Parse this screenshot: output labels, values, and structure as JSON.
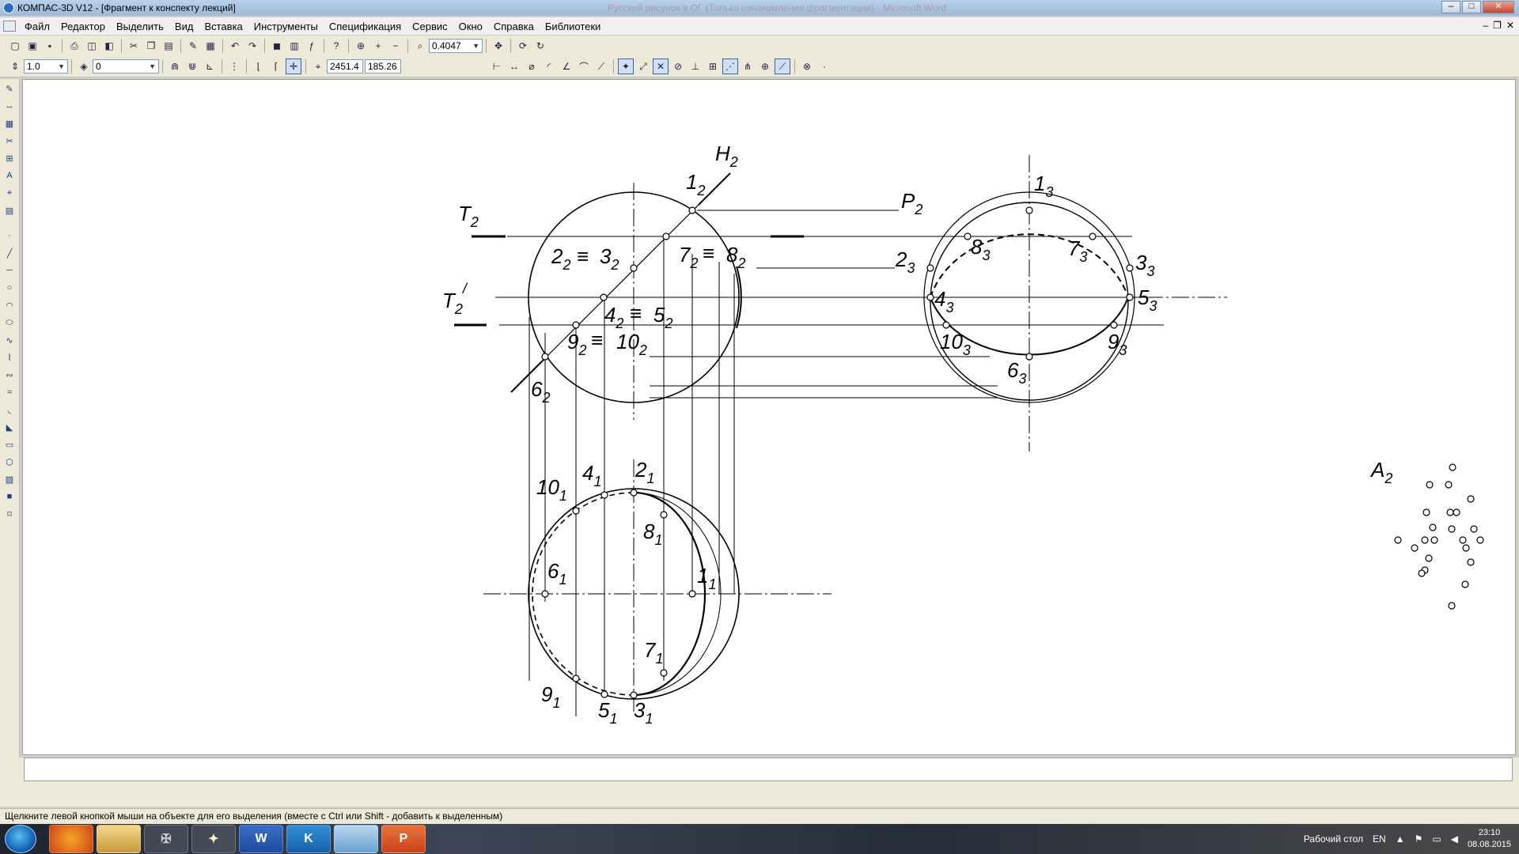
{
  "window": {
    "title": "КОМПАС-3D V12 - [Фрагмент к конспекту лекций]",
    "blurred_tab": "Русский рисунок в ОГ (Только ознакомления фрагментации) - Microsoft Word",
    "minimize": "–",
    "maximize": "□",
    "close": "✕"
  },
  "menu": {
    "items": [
      "Файл",
      "Редактор",
      "Выделить",
      "Вид",
      "Вставка",
      "Инструменты",
      "Спецификация",
      "Сервис",
      "Окно",
      "Справка",
      "Библиотеки"
    ],
    "doc_min": "–",
    "doc_restore": "❐",
    "doc_close": "✕"
  },
  "toolbar1": {
    "zoom_value": "0.4047"
  },
  "toolbar2": {
    "step_value": "1.0",
    "layer_value": "0",
    "coord_x": "2451.4",
    "coord_y": "185.26"
  },
  "drawing": {
    "labels": [
      {
        "main": "H",
        "sub": "2"
      },
      {
        "main": "1",
        "sub": "2"
      },
      {
        "main": "T",
        "sub": "2"
      },
      {
        "main": "P",
        "sub": "2"
      },
      {
        "main": "1",
        "sub": "3"
      },
      {
        "main": "2",
        "sub": "2"
      },
      {
        "main": "≡",
        "sub": ""
      },
      {
        "main": "3",
        "sub": "2"
      },
      {
        "main": "7",
        "sub": "2"
      },
      {
        "main": "≡",
        "sub": ""
      },
      {
        "main": "8",
        "sub": "2"
      },
      {
        "main": "2",
        "sub": "3"
      },
      {
        "main": "8",
        "sub": "3"
      },
      {
        "main": "7",
        "sub": "3"
      },
      {
        "main": "3",
        "sub": "3"
      },
      {
        "main": "T",
        "sub": "2"
      },
      {
        "main": "4",
        "sub": "2"
      },
      {
        "main": "≡",
        "sub": ""
      },
      {
        "main": "5",
        "sub": "2"
      },
      {
        "main": "4",
        "sub": "3"
      },
      {
        "main": "5",
        "sub": "3"
      },
      {
        "main": "9",
        "sub": "2"
      },
      {
        "main": "≡",
        "sub": ""
      },
      {
        "main": "10",
        "sub": "2"
      },
      {
        "main": "10",
        "sub": "3"
      },
      {
        "main": "9",
        "sub": "3"
      },
      {
        "main": "6",
        "sub": "3"
      },
      {
        "main": "6",
        "sub": "2"
      },
      {
        "main": "10",
        "sub": "1"
      },
      {
        "main": "4",
        "sub": "1"
      },
      {
        "main": "2",
        "sub": "1"
      },
      {
        "main": "8",
        "sub": "1"
      },
      {
        "main": "6",
        "sub": "1"
      },
      {
        "main": "1",
        "sub": "1"
      },
      {
        "main": "7",
        "sub": "1"
      },
      {
        "main": "9",
        "sub": "1"
      },
      {
        "main": "5",
        "sub": "1"
      },
      {
        "main": "3",
        "sub": "1"
      },
      {
        "main": "A",
        "sub": "2"
      }
    ],
    "t_prime_mark": "/"
  },
  "status": {
    "hint": "Щелкните левой кнопкой мыши на объекте для его выделения (вместе с Ctrl или Shift - добавить к выделенным)"
  },
  "taskbar": {
    "desktop_label": "Рабочий стол",
    "lang": "EN",
    "time": "23:10",
    "date": "08.08.2015",
    "apps": [
      "Firefox",
      "Проводник",
      "World of Tanks",
      "Игра",
      "Word",
      "КОМПАС-3D",
      "Paint",
      "PowerPoint"
    ]
  }
}
